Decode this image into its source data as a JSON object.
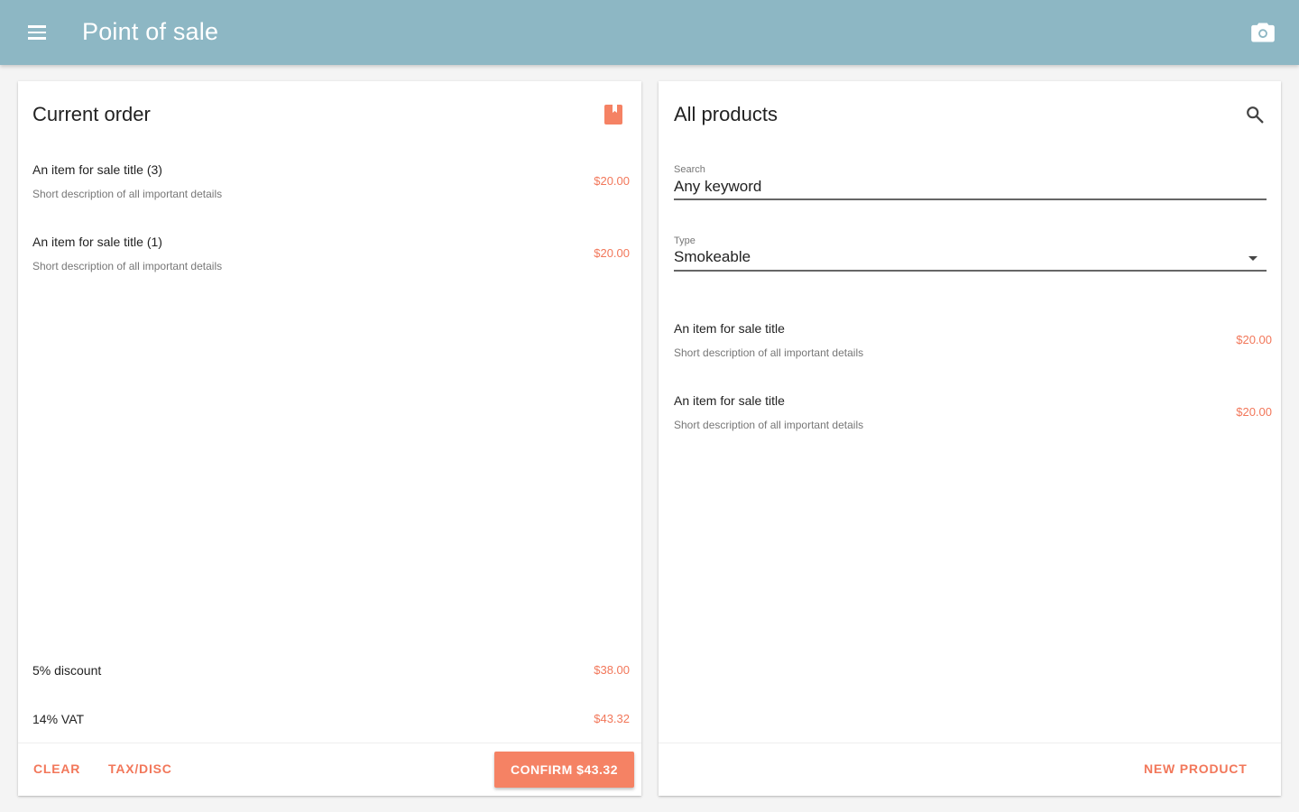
{
  "appbar": {
    "title": "Point of sale",
    "menu_icon": "menu-icon",
    "camera_icon": "camera-icon",
    "background_color": "#8db7c4"
  },
  "current_order": {
    "title": "Current order",
    "icon": "bookmark-icon",
    "items": [
      {
        "title": "An item for sale title (3)",
        "description": "Short description of all important details",
        "price": "$20.00"
      },
      {
        "title": "An item for sale title (1)",
        "description": "Short description of all important details",
        "price": "$20.00"
      }
    ],
    "summary": [
      {
        "label": "5% discount",
        "value": "$38.00"
      },
      {
        "label": "14% VAT",
        "value": "$43.32"
      }
    ],
    "footer": {
      "clear_label": "CLEAR",
      "taxdisc_label": "TAX/DISC",
      "confirm_label": "CONFIRM $43.32"
    }
  },
  "all_products": {
    "title": "All products",
    "icon": "search-icon",
    "search": {
      "label": "Search",
      "value": "Any keyword"
    },
    "type": {
      "label": "Type",
      "value": "Smokeable"
    },
    "items": [
      {
        "title": "An item for sale title",
        "description": "Short description of all important details",
        "price": "$20.00"
      },
      {
        "title": "An item for sale title",
        "description": "Short description of all important details",
        "price": "$20.00"
      }
    ],
    "footer": {
      "new_product_label": "NEW PRODUCT"
    }
  },
  "colors": {
    "accent": "#f2775a",
    "confirm_button": "#f58264"
  }
}
